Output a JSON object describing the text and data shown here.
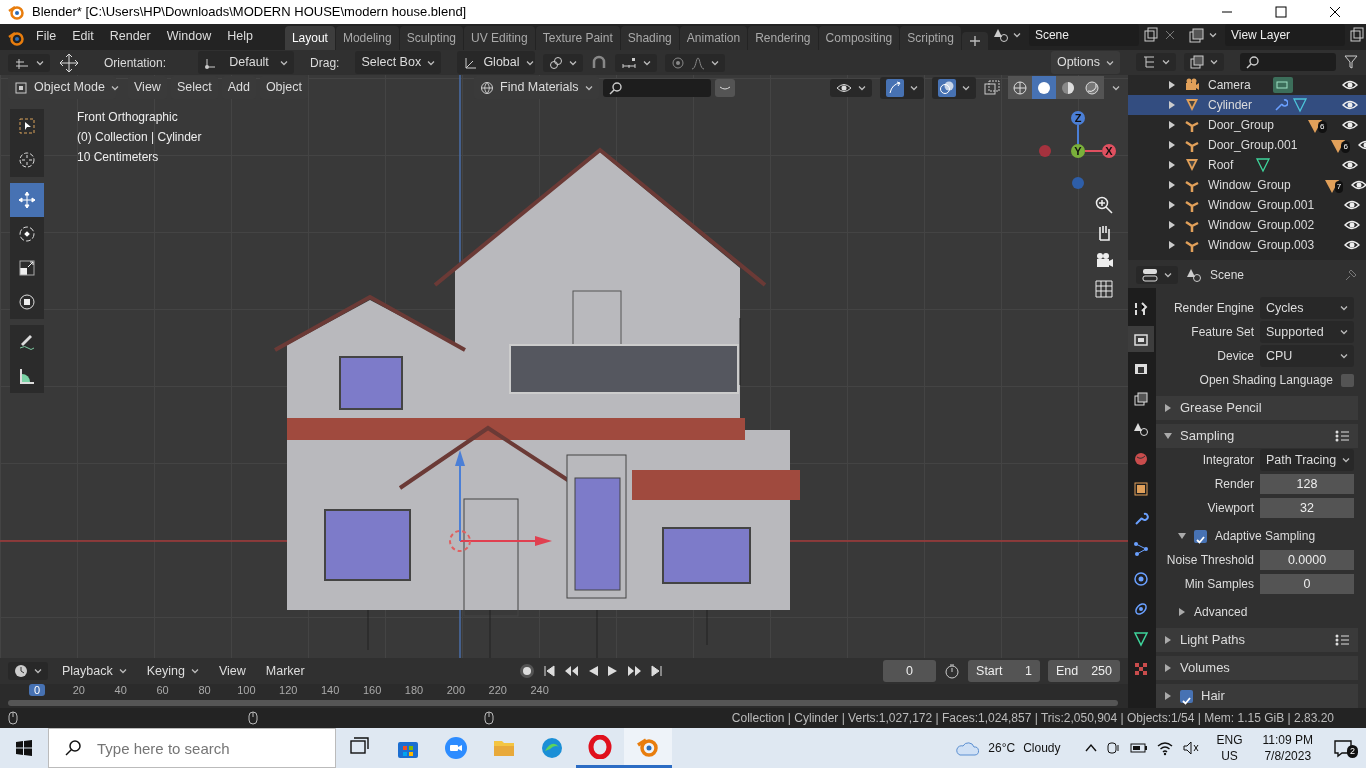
{
  "window": {
    "title": "Blender* [C:\\Users\\HP\\Downloads\\MODERN HOUSE\\modern house.blend]"
  },
  "menu": [
    "File",
    "Edit",
    "Render",
    "Window",
    "Help"
  ],
  "workspaces": [
    {
      "label": "Layout",
      "selected": true
    },
    {
      "label": "Modeling",
      "selected": false
    },
    {
      "label": "Sculpting",
      "selected": false
    },
    {
      "label": "UV Editing",
      "selected": false
    },
    {
      "label": "Texture Paint",
      "selected": false
    },
    {
      "label": "Shading",
      "selected": false
    },
    {
      "label": "Animation",
      "selected": false
    },
    {
      "label": "Rendering",
      "selected": false
    },
    {
      "label": "Compositing",
      "selected": false
    },
    {
      "label": "Scripting",
      "selected": false
    }
  ],
  "scene": "Scene",
  "view_layer": "View Layer",
  "tool_settings": {
    "orientation_label": "Orientation:",
    "orientation": "Default",
    "drag_label": "Drag:",
    "drag": "Select Box",
    "pivot": "Global",
    "options": "Options"
  },
  "viewport_header": {
    "mode": "Object Mode",
    "menus": [
      "View",
      "Select",
      "Add",
      "Object"
    ],
    "find_materials": "Find Materials"
  },
  "shading_modes": [
    {
      "kind": "wireframe",
      "selected": false
    },
    {
      "kind": "solid",
      "selected": true
    },
    {
      "kind": "material",
      "selected": false
    },
    {
      "kind": "rendered",
      "selected": false
    }
  ],
  "tools": [
    {
      "kind": "select",
      "selected": false
    },
    {
      "kind": "cursor",
      "selected": false
    },
    {
      "kind": "move",
      "selected": true
    },
    {
      "kind": "rotate",
      "selected": false
    },
    {
      "kind": "scale",
      "selected": false
    },
    {
      "kind": "transform",
      "selected": false
    },
    {
      "kind": "annotate",
      "selected": false
    },
    {
      "kind": "measure",
      "selected": false
    }
  ],
  "overlay_text": [
    "Front Orthographic",
    "(0) Collection | Cylinder",
    "10 Centimeters"
  ],
  "gizmo": {
    "x": "X",
    "y": "Y",
    "z": "Z"
  },
  "outliner": [
    {
      "name": "Camera",
      "kind": "camera",
      "selected": false,
      "badges": [
        {
          "kind": "camera_data"
        }
      ]
    },
    {
      "name": "Cylinder",
      "kind": "mesh",
      "selected": true,
      "badges": [
        {
          "kind": "modifier"
        },
        {
          "kind": "mesh_data"
        }
      ]
    },
    {
      "name": "Door_Group",
      "kind": "empty",
      "selected": false,
      "badges": [
        {
          "kind": "children",
          "count": "6"
        }
      ]
    },
    {
      "name": "Door_Group.001",
      "kind": "empty",
      "selected": false,
      "badges": [
        {
          "kind": "children",
          "count": "6"
        }
      ]
    },
    {
      "name": "Roof",
      "kind": "mesh",
      "selected": false,
      "badges": [
        {
          "kind": "mesh_data"
        }
      ]
    },
    {
      "name": "Window_Group",
      "kind": "empty",
      "selected": false,
      "badges": [
        {
          "kind": "children",
          "count": "7"
        }
      ]
    },
    {
      "name": "Window_Group.001",
      "kind": "empty",
      "selected": false
    },
    {
      "name": "Window_Group.002",
      "kind": "empty",
      "selected": false
    },
    {
      "name": "Window_Group.003",
      "kind": "empty",
      "selected": false
    }
  ],
  "properties": {
    "context": "Scene",
    "tabs": [
      {
        "kind": "tool",
        "selected": false
      },
      {
        "kind": "render",
        "selected": true
      },
      {
        "kind": "output",
        "selected": false
      },
      {
        "kind": "view_layer",
        "selected": false
      },
      {
        "kind": "scene",
        "selected": false
      },
      {
        "kind": "world",
        "selected": false
      },
      {
        "kind": "object",
        "selected": false
      },
      {
        "kind": "modifier",
        "selected": false
      },
      {
        "kind": "particles",
        "selected": false
      },
      {
        "kind": "physics",
        "selected": false
      },
      {
        "kind": "constraints",
        "selected": false
      },
      {
        "kind": "data",
        "selected": false
      },
      {
        "kind": "material",
        "selected": false
      }
    ],
    "rows": [
      {
        "kind": "dropdown",
        "label": "Render Engine",
        "value": "Cycles"
      },
      {
        "kind": "dropdown",
        "label": "Feature Set",
        "value": "Supported"
      },
      {
        "kind": "dropdown",
        "label": "Device",
        "value": "CPU"
      },
      {
        "kind": "checkbox",
        "label": "Open Shading Language",
        "checked": false
      },
      {
        "kind": "panel",
        "label": "Grease Pencil",
        "expanded": false,
        "presets": false
      },
      {
        "kind": "panel",
        "label": "Sampling",
        "expanded": true,
        "presets": true
      },
      {
        "kind": "dropdown",
        "label": "Integrator",
        "value": "Path Tracing"
      },
      {
        "kind": "number",
        "label": "Render",
        "value": "128"
      },
      {
        "kind": "number",
        "label": "Viewport",
        "value": "32"
      },
      {
        "kind": "subpanel",
        "label": "Adaptive Sampling",
        "expanded": true,
        "checked": true
      },
      {
        "kind": "number",
        "label": "Noise Threshold",
        "value": "0.0000"
      },
      {
        "kind": "number",
        "label": "Min Samples",
        "value": "0"
      },
      {
        "kind": "subpanel",
        "label": "Advanced",
        "expanded": false
      },
      {
        "kind": "panel",
        "label": "Light Paths",
        "expanded": false,
        "presets": true
      },
      {
        "kind": "panel",
        "label": "Volumes",
        "expanded": false,
        "presets": false
      },
      {
        "kind": "panel",
        "label": "Hair",
        "expanded": false,
        "presets": false,
        "checked": true
      }
    ]
  },
  "timeline": {
    "menus": [
      "Playback",
      "Keying",
      "View",
      "Marker"
    ],
    "current_frame": "0",
    "start_label": "Start",
    "start": "1",
    "end_label": "End",
    "end": "250",
    "ruler": [
      {
        "label": "0",
        "selected": true
      },
      {
        "label": "20",
        "selected": false
      },
      {
        "label": "40",
        "selected": false
      },
      {
        "label": "60",
        "selected": false
      },
      {
        "label": "80",
        "selected": false
      },
      {
        "label": "100",
        "selected": false
      },
      {
        "label": "120",
        "selected": false
      },
      {
        "label": "140",
        "selected": false
      },
      {
        "label": "160",
        "selected": false
      },
      {
        "label": "180",
        "selected": false
      },
      {
        "label": "200",
        "selected": false
      },
      {
        "label": "220",
        "selected": false
      },
      {
        "label": "240",
        "selected": false
      }
    ]
  },
  "status_bar": "Collection | Cylinder | Verts:1,027,172 | Faces:1,024,857 | Tris:2,050,904 | Objects:1/54 | Mem: 1.15 GiB | 2.83.20",
  "taskbar": {
    "search": {
      "placeholder": "Type here to search"
    },
    "apps": [
      {
        "kind": "task_view",
        "running": false,
        "selected": false
      },
      {
        "kind": "store",
        "running": false,
        "selected": false
      },
      {
        "kind": "zoom",
        "running": false,
        "selected": false
      },
      {
        "kind": "explorer",
        "running": false,
        "selected": false
      },
      {
        "kind": "edge",
        "running": false,
        "selected": false
      },
      {
        "kind": "opera",
        "running": true,
        "selected": false
      },
      {
        "kind": "blender",
        "running": true,
        "selected": true
      }
    ],
    "temperature": "26°C",
    "weather": "Cloudy",
    "language": "ENG",
    "region": "US",
    "time": "11:09 PM",
    "date": "7/8/2023",
    "notifications": "2"
  }
}
